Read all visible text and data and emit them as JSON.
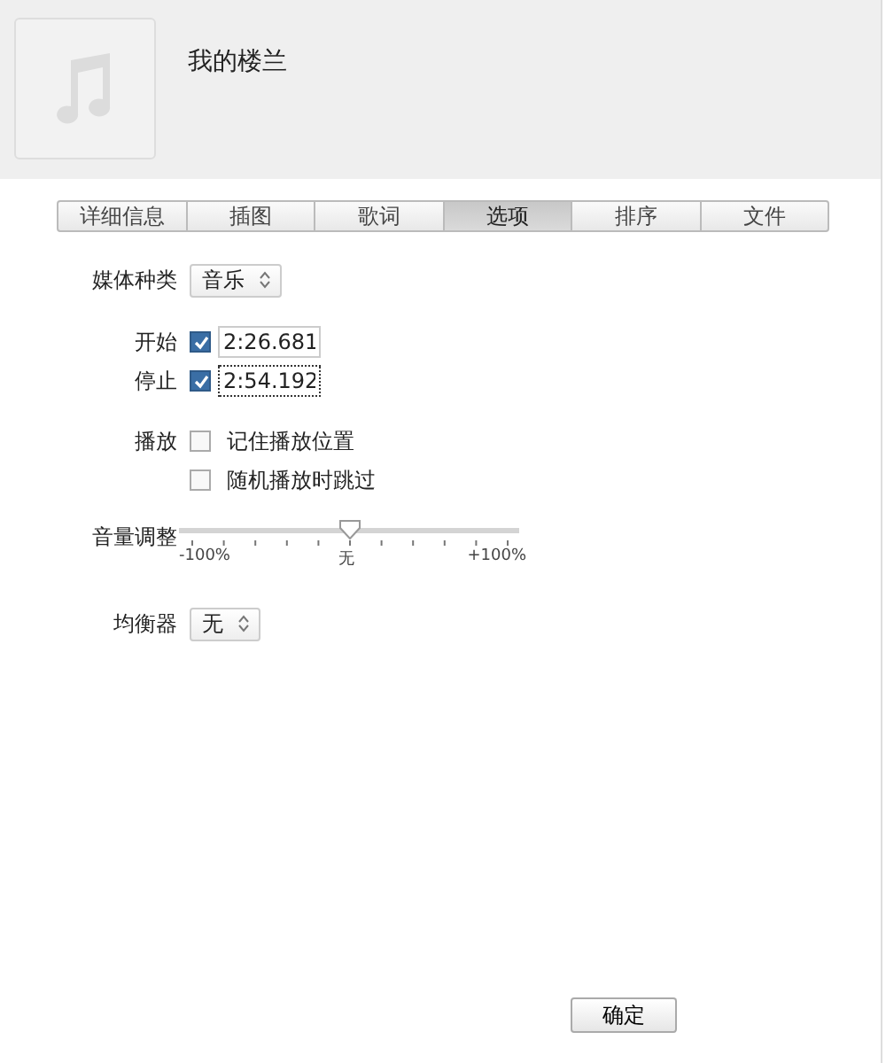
{
  "header": {
    "title": "我的楼兰"
  },
  "tabs": [
    {
      "label": "详细信息",
      "selected": false
    },
    {
      "label": "插图",
      "selected": false
    },
    {
      "label": "歌词",
      "selected": false
    },
    {
      "label": "选项",
      "selected": true
    },
    {
      "label": "排序",
      "selected": false
    },
    {
      "label": "文件",
      "selected": false
    }
  ],
  "media_kind": {
    "label": "媒体种类",
    "value": "音乐"
  },
  "start": {
    "label": "开始",
    "checked": true,
    "value": "2:26.681"
  },
  "stop": {
    "label": "停止",
    "checked": true,
    "value": "2:54.192",
    "focused": true
  },
  "playback": {
    "label": "播放",
    "options": [
      {
        "label": "记住播放位置",
        "checked": false
      },
      {
        "label": "随机播放时跳过",
        "checked": false
      }
    ]
  },
  "volume": {
    "label": "音量调整",
    "level": 0.5,
    "min_label": "-100%",
    "mid_label": "无",
    "max_label": "+100%"
  },
  "equalizer": {
    "label": "均衡器",
    "value": "无"
  },
  "buttons": [
    "确定"
  ]
}
